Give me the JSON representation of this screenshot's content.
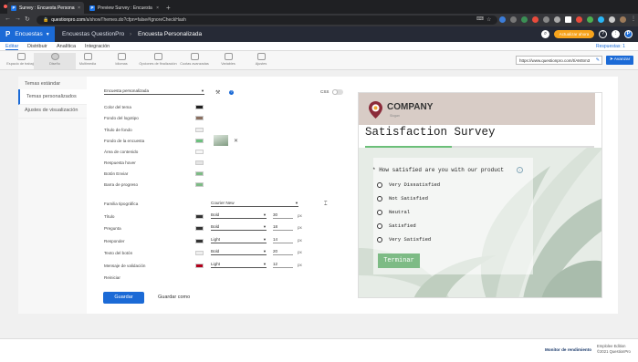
{
  "browser": {
    "tabs": [
      {
        "title": "Survey : Encuesta Personaliza",
        "icon": "P",
        "active": true
      },
      {
        "title": "Preview Survey : Encuesta Pe",
        "icon": "P",
        "active": false
      }
    ],
    "url_host": "questionpro.com",
    "url_path": "/a/showThemes.do?cfpn=false#IgnoreCheckHash"
  },
  "app": {
    "name": "Encuestas",
    "logo": "P",
    "breadcrumb": [
      "Encuestas QuestionPro",
      "Encuesta Personalizada"
    ],
    "upgrade_label": "Actualizar ahora",
    "help_label": "?",
    "user_initial": "P"
  },
  "menu": {
    "items": [
      "Editar",
      "Distribuir",
      "Analítica",
      "Integración"
    ],
    "active": "Editar",
    "responses_label": "Respuestas: 1"
  },
  "toolbar": {
    "tools": [
      "Espacio de trabajo",
      "Diseño",
      "Multimedia",
      "Idiomas",
      "Opciones de finalización",
      "Cuotas avanzadas",
      "Variables",
      "Ajustes"
    ],
    "selected": "Diseño",
    "survey_url": "https://www.questionpro.com/t/AMSm3",
    "advance_label": "Avanzar"
  },
  "sidebar": {
    "items": [
      "Temas estándar",
      "Temas personalizados",
      "Ajustes de visualización"
    ],
    "active": "Temas personalizados"
  },
  "theme_editor": {
    "theme_select": "Encuesta personalizada",
    "css_label": "CSS",
    "colors": [
      {
        "label": "Color del tema",
        "color": "#1e1e1e"
      },
      {
        "label": "Fondo del logotipo",
        "color": "#8a6f60"
      },
      {
        "label": "Título de fondo",
        "color": "#eeeeee"
      },
      {
        "label": "Fondo de la encuesta",
        "color": "#6cc07e"
      },
      {
        "label": "Área de contenido",
        "color": "#f6f6f6"
      },
      {
        "label": "Respuesta hover",
        "color": "#e4e4e4"
      },
      {
        "label": "Botón Enviar",
        "color": "#7dbb85"
      },
      {
        "label": "Barra de progreso",
        "color": "#7dbb85"
      }
    ],
    "font_family_label": "Familia tipográfica",
    "font_family_value": "Courier New",
    "fonts": [
      {
        "label": "Título",
        "color": "#333333",
        "weight": "Bold",
        "size": "30"
      },
      {
        "label": "Pregunta",
        "color": "#333333",
        "weight": "Bold",
        "size": "18"
      },
      {
        "label": "Responder",
        "color": "#333333",
        "weight": "Light",
        "size": "14"
      },
      {
        "label": "Texto del botón",
        "color": "#eeeeee",
        "weight": "Bold",
        "size": "20"
      },
      {
        "label": "Mensaje de validación",
        "color": "#b3001b",
        "weight": "Light",
        "size": "12"
      }
    ],
    "unit": "px",
    "reset_label": "Reiniciar",
    "save_label": "Guardar",
    "save_as_label": "Guardar como"
  },
  "preview": {
    "company": "COMPANY",
    "slogan": "Slogan",
    "title": "Satisfaction Survey",
    "progress": 0.38,
    "question": "How satisfied are you with our product",
    "options": [
      "Very Dissatisfied",
      "Not Satisfied",
      "Neutral",
      "Satisfied",
      "Very Satisfied"
    ],
    "finish_label": "Terminar"
  },
  "footer": {
    "monitor_label": "Monitor de rendimiento",
    "edition": "Emplolee Edition",
    "copyright": "©2021 QuestionPro"
  }
}
